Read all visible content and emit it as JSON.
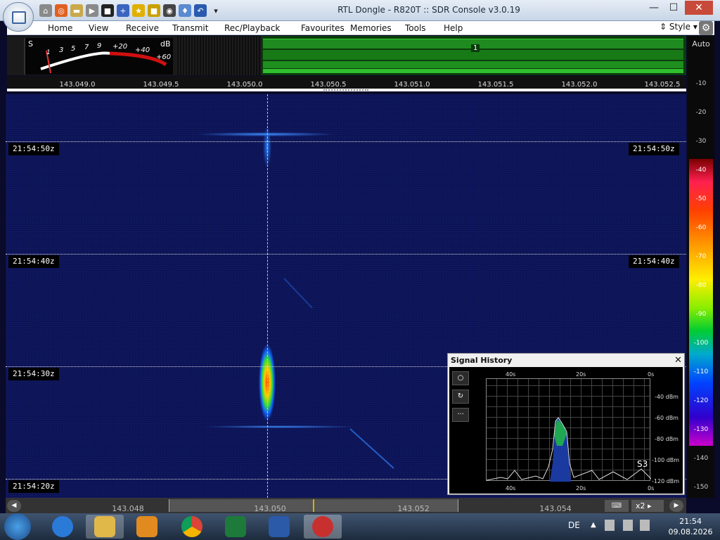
{
  "window": {
    "title": "RTL Dongle - R820T :: SDR Console v3.0.19",
    "minimize": "—",
    "maximize": "☐",
    "close": "✕"
  },
  "menu": {
    "items": [
      "Home",
      "View",
      "Receive",
      "Transmit",
      "Rec/Playback",
      "Favourites",
      "Memories",
      "Tools",
      "Help"
    ],
    "style_label": "Style"
  },
  "smeter": {
    "s_label": "S",
    "db_label": "dB",
    "scale": [
      "1",
      "3",
      "5",
      "7",
      "9",
      "+20",
      "+40",
      "+60"
    ]
  },
  "band": {
    "marker": "1"
  },
  "freq_ruler": [
    "143.049.0",
    "143.049.5",
    "143.050.0",
    "143.050.5",
    "143.051.0",
    "143.051.5",
    "143.052.0",
    "143.052.5"
  ],
  "waterfall": {
    "timestamps": [
      "21:54:50z",
      "21:54:40z",
      "21:54:30z",
      "21:54:20z"
    ]
  },
  "db_scale": {
    "auto_label": "Auto",
    "ticks": [
      "-10",
      "-20",
      "-30",
      "-40",
      "-50",
      "-60",
      "-70",
      "-80",
      "-90",
      "-100",
      "-110",
      "-120",
      "-130",
      "-140",
      "-150"
    ]
  },
  "signal_history": {
    "title": "Signal History",
    "close": "✕",
    "x_top": [
      "40s",
      "20s",
      "0s"
    ],
    "x_bottom": [
      "40s",
      "20s",
      "0s"
    ],
    "y_labels": [
      "-40 dBm",
      "-60 dBm",
      "-80 dBm",
      "-100 dBm",
      "-120 dBm"
    ],
    "s_reading": "S3",
    "buttons": [
      "○",
      "↻",
      "···"
    ]
  },
  "bottom_bar": {
    "freqs": [
      "143.048",
      "143.050",
      "143.052",
      "143.054"
    ],
    "zoom": "x2"
  },
  "taskbar": {
    "lang": "DE",
    "time": "21:54",
    "date": "09.08.2026"
  },
  "colors": {
    "accent": "#1a6fd6",
    "band_green": "#22aa22",
    "titlebar": "#c9d6e7"
  },
  "icons": [
    "home-icon",
    "lifebuoy-icon",
    "folder-icon",
    "play-icon",
    "stop-icon",
    "add-icon",
    "favourite-star-icon",
    "lock-icon",
    "camera-icon",
    "drop-icon",
    "undo-icon",
    "dropdown-icon"
  ]
}
